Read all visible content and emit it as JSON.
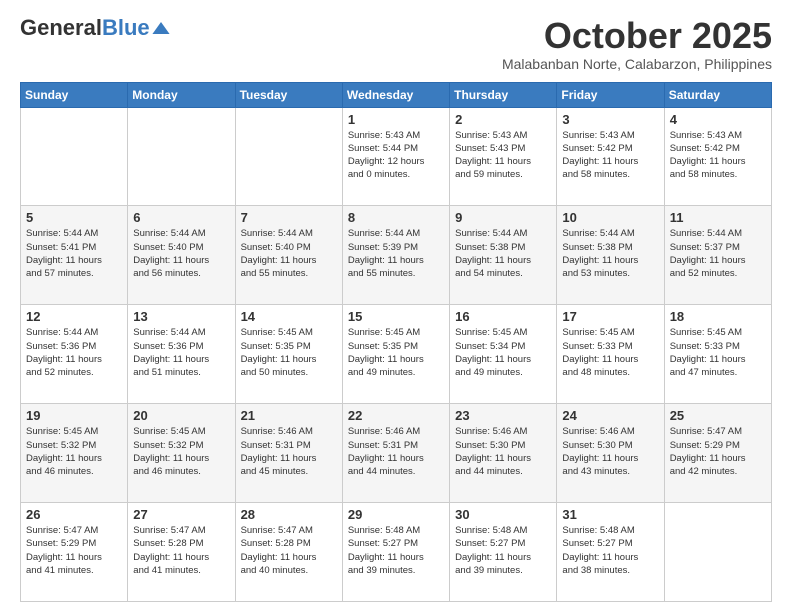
{
  "header": {
    "logo_general": "General",
    "logo_blue": "Blue",
    "month_title": "October 2025",
    "location": "Malabanban Norte, Calabarzon, Philippines"
  },
  "days_of_week": [
    "Sunday",
    "Monday",
    "Tuesday",
    "Wednesday",
    "Thursday",
    "Friday",
    "Saturday"
  ],
  "weeks": [
    [
      {
        "num": "",
        "info": ""
      },
      {
        "num": "",
        "info": ""
      },
      {
        "num": "",
        "info": ""
      },
      {
        "num": "1",
        "info": "Sunrise: 5:43 AM\nSunset: 5:44 PM\nDaylight: 12 hours\nand 0 minutes."
      },
      {
        "num": "2",
        "info": "Sunrise: 5:43 AM\nSunset: 5:43 PM\nDaylight: 11 hours\nand 59 minutes."
      },
      {
        "num": "3",
        "info": "Sunrise: 5:43 AM\nSunset: 5:42 PM\nDaylight: 11 hours\nand 58 minutes."
      },
      {
        "num": "4",
        "info": "Sunrise: 5:43 AM\nSunset: 5:42 PM\nDaylight: 11 hours\nand 58 minutes."
      }
    ],
    [
      {
        "num": "5",
        "info": "Sunrise: 5:44 AM\nSunset: 5:41 PM\nDaylight: 11 hours\nand 57 minutes."
      },
      {
        "num": "6",
        "info": "Sunrise: 5:44 AM\nSunset: 5:40 PM\nDaylight: 11 hours\nand 56 minutes."
      },
      {
        "num": "7",
        "info": "Sunrise: 5:44 AM\nSunset: 5:40 PM\nDaylight: 11 hours\nand 55 minutes."
      },
      {
        "num": "8",
        "info": "Sunrise: 5:44 AM\nSunset: 5:39 PM\nDaylight: 11 hours\nand 55 minutes."
      },
      {
        "num": "9",
        "info": "Sunrise: 5:44 AM\nSunset: 5:38 PM\nDaylight: 11 hours\nand 54 minutes."
      },
      {
        "num": "10",
        "info": "Sunrise: 5:44 AM\nSunset: 5:38 PM\nDaylight: 11 hours\nand 53 minutes."
      },
      {
        "num": "11",
        "info": "Sunrise: 5:44 AM\nSunset: 5:37 PM\nDaylight: 11 hours\nand 52 minutes."
      }
    ],
    [
      {
        "num": "12",
        "info": "Sunrise: 5:44 AM\nSunset: 5:36 PM\nDaylight: 11 hours\nand 52 minutes."
      },
      {
        "num": "13",
        "info": "Sunrise: 5:44 AM\nSunset: 5:36 PM\nDaylight: 11 hours\nand 51 minutes."
      },
      {
        "num": "14",
        "info": "Sunrise: 5:45 AM\nSunset: 5:35 PM\nDaylight: 11 hours\nand 50 minutes."
      },
      {
        "num": "15",
        "info": "Sunrise: 5:45 AM\nSunset: 5:35 PM\nDaylight: 11 hours\nand 49 minutes."
      },
      {
        "num": "16",
        "info": "Sunrise: 5:45 AM\nSunset: 5:34 PM\nDaylight: 11 hours\nand 49 minutes."
      },
      {
        "num": "17",
        "info": "Sunrise: 5:45 AM\nSunset: 5:33 PM\nDaylight: 11 hours\nand 48 minutes."
      },
      {
        "num": "18",
        "info": "Sunrise: 5:45 AM\nSunset: 5:33 PM\nDaylight: 11 hours\nand 47 minutes."
      }
    ],
    [
      {
        "num": "19",
        "info": "Sunrise: 5:45 AM\nSunset: 5:32 PM\nDaylight: 11 hours\nand 46 minutes."
      },
      {
        "num": "20",
        "info": "Sunrise: 5:45 AM\nSunset: 5:32 PM\nDaylight: 11 hours\nand 46 minutes."
      },
      {
        "num": "21",
        "info": "Sunrise: 5:46 AM\nSunset: 5:31 PM\nDaylight: 11 hours\nand 45 minutes."
      },
      {
        "num": "22",
        "info": "Sunrise: 5:46 AM\nSunset: 5:31 PM\nDaylight: 11 hours\nand 44 minutes."
      },
      {
        "num": "23",
        "info": "Sunrise: 5:46 AM\nSunset: 5:30 PM\nDaylight: 11 hours\nand 44 minutes."
      },
      {
        "num": "24",
        "info": "Sunrise: 5:46 AM\nSunset: 5:30 PM\nDaylight: 11 hours\nand 43 minutes."
      },
      {
        "num": "25",
        "info": "Sunrise: 5:47 AM\nSunset: 5:29 PM\nDaylight: 11 hours\nand 42 minutes."
      }
    ],
    [
      {
        "num": "26",
        "info": "Sunrise: 5:47 AM\nSunset: 5:29 PM\nDaylight: 11 hours\nand 41 minutes."
      },
      {
        "num": "27",
        "info": "Sunrise: 5:47 AM\nSunset: 5:28 PM\nDaylight: 11 hours\nand 41 minutes."
      },
      {
        "num": "28",
        "info": "Sunrise: 5:47 AM\nSunset: 5:28 PM\nDaylight: 11 hours\nand 40 minutes."
      },
      {
        "num": "29",
        "info": "Sunrise: 5:48 AM\nSunset: 5:27 PM\nDaylight: 11 hours\nand 39 minutes."
      },
      {
        "num": "30",
        "info": "Sunrise: 5:48 AM\nSunset: 5:27 PM\nDaylight: 11 hours\nand 39 minutes."
      },
      {
        "num": "31",
        "info": "Sunrise: 5:48 AM\nSunset: 5:27 PM\nDaylight: 11 hours\nand 38 minutes."
      },
      {
        "num": "",
        "info": ""
      }
    ]
  ]
}
